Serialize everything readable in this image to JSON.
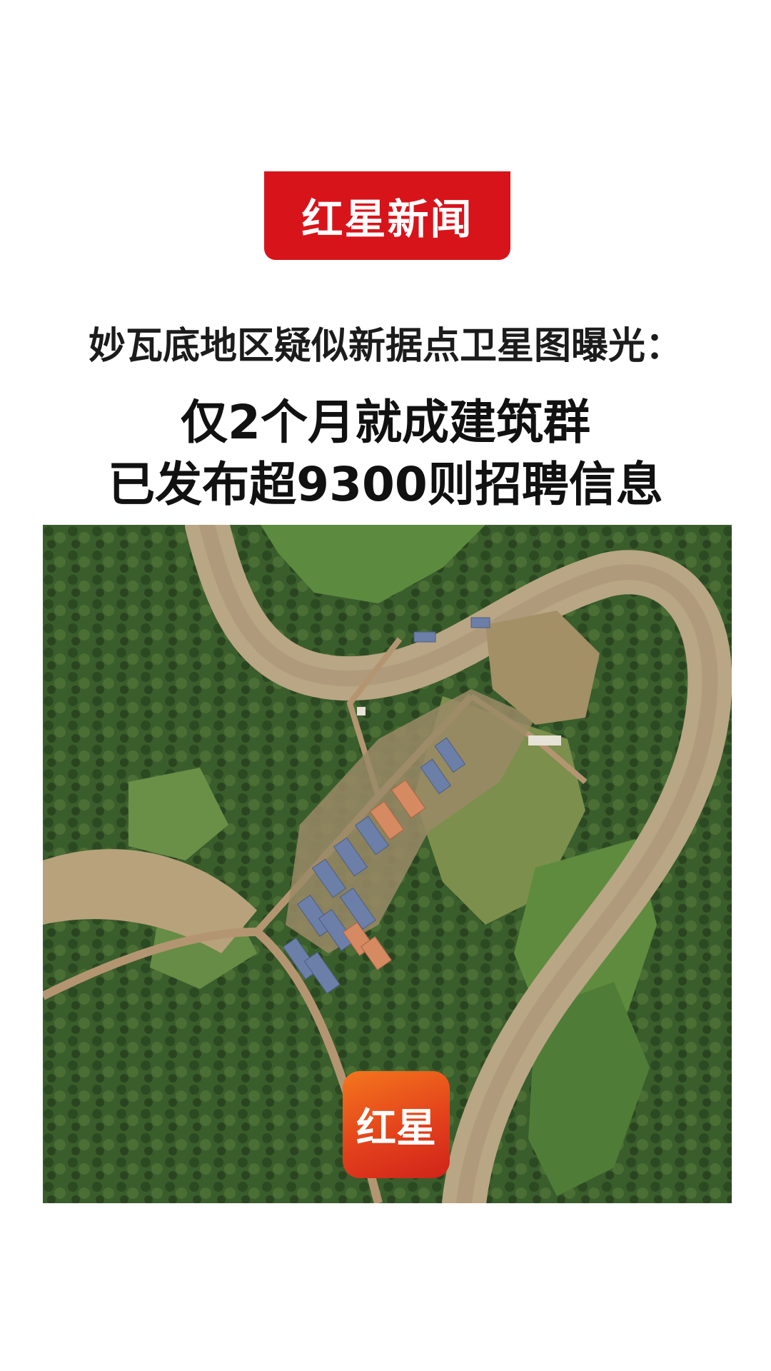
{
  "brand": {
    "logo_text": "红星新闻"
  },
  "subtitle": "妙瓦底地区疑似新据点卫星图曝光：",
  "headline": {
    "line1": "仅2个月就成建筑群",
    "line2": "已发布超9300则招聘信息"
  },
  "image": {
    "content": "satellite-view",
    "watermark_text": "红星",
    "watermark_colors": [
      "#f4761d",
      "#d0231a"
    ]
  }
}
